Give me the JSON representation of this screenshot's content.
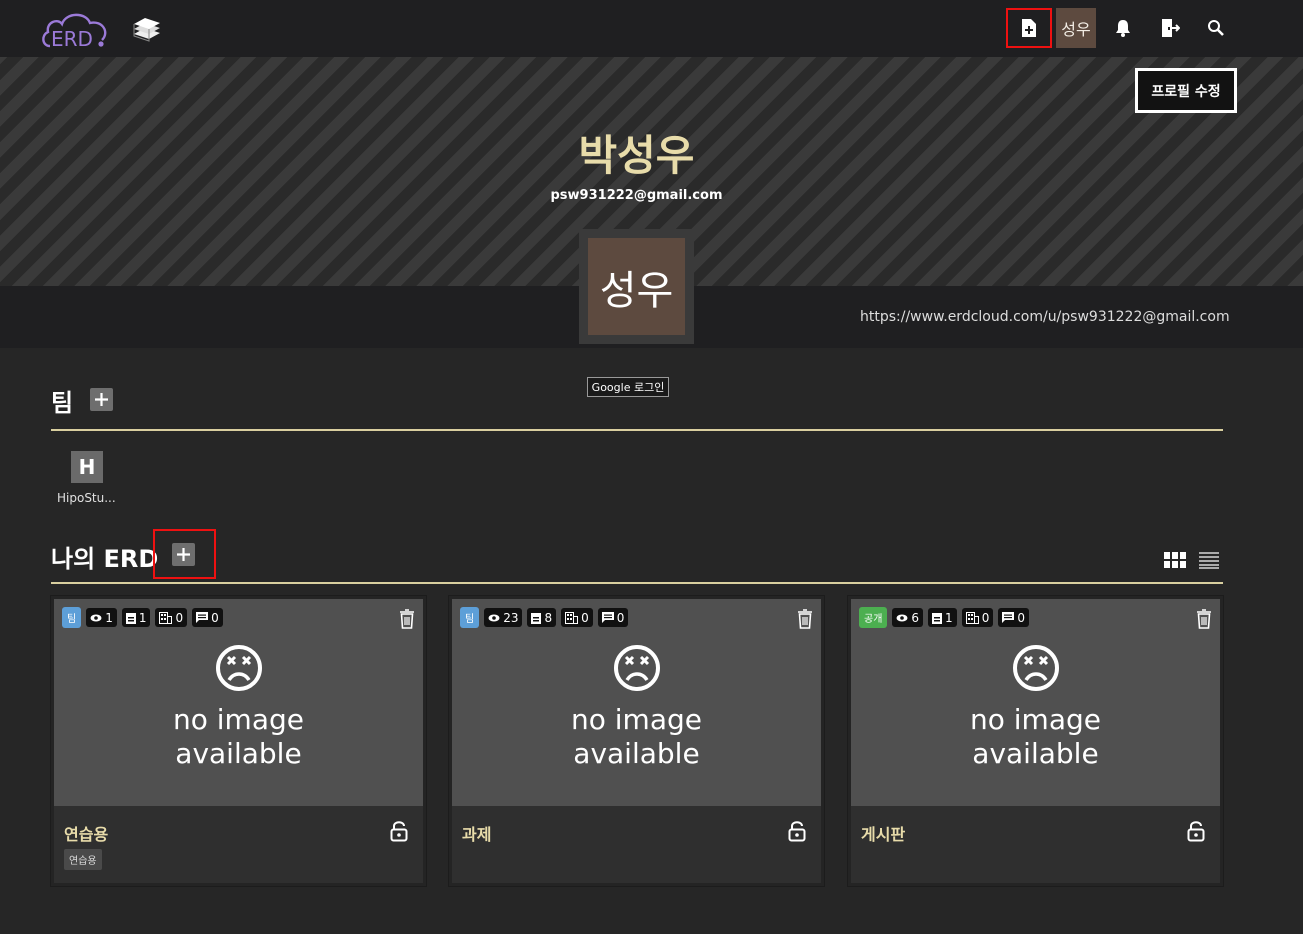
{
  "header": {
    "logo_text": "ERD",
    "icons": [
      "cloud-logo-icon",
      "books-icon",
      "new-file-icon",
      "bell-icon",
      "logout-icon",
      "search-icon"
    ],
    "avatar_initials": "성우"
  },
  "profile": {
    "edit_button": "프로필 수정",
    "name": "박성우",
    "email": "psw931222@gmail.com",
    "avatar_initials": "성우",
    "url": "https://www.erdcloud.com/u/psw931222@gmail.com",
    "tooltip": "Google 로그인"
  },
  "teams": {
    "title": "팀",
    "items": [
      {
        "initial": "H",
        "name": "HipoStu..."
      }
    ]
  },
  "my_erd": {
    "title": "나의 ERD",
    "cards": [
      {
        "type": "팀",
        "type_color": "#5d9fd8",
        "views": "1",
        "docs": "1",
        "tables": "0",
        "comments": "0",
        "noimage_line1": "no image",
        "noimage_line2": "available",
        "title": "연습용",
        "tag": "연습용"
      },
      {
        "type": "팀",
        "type_color": "#5d9fd8",
        "views": "23",
        "docs": "8",
        "tables": "0",
        "comments": "0",
        "noimage_line1": "no image",
        "noimage_line2": "available",
        "title": "과제",
        "tag": ""
      },
      {
        "type": "공개",
        "type_color": "#4caf50",
        "views": "6",
        "docs": "1",
        "tables": "0",
        "comments": "0",
        "noimage_line1": "no image",
        "noimage_line2": "available",
        "title": "게시판",
        "tag": ""
      }
    ]
  },
  "colors": {
    "accent_gold": "#e8dcaa",
    "highlight_red": "#ee1111",
    "avatar_brown": "#5d4a3f"
  }
}
